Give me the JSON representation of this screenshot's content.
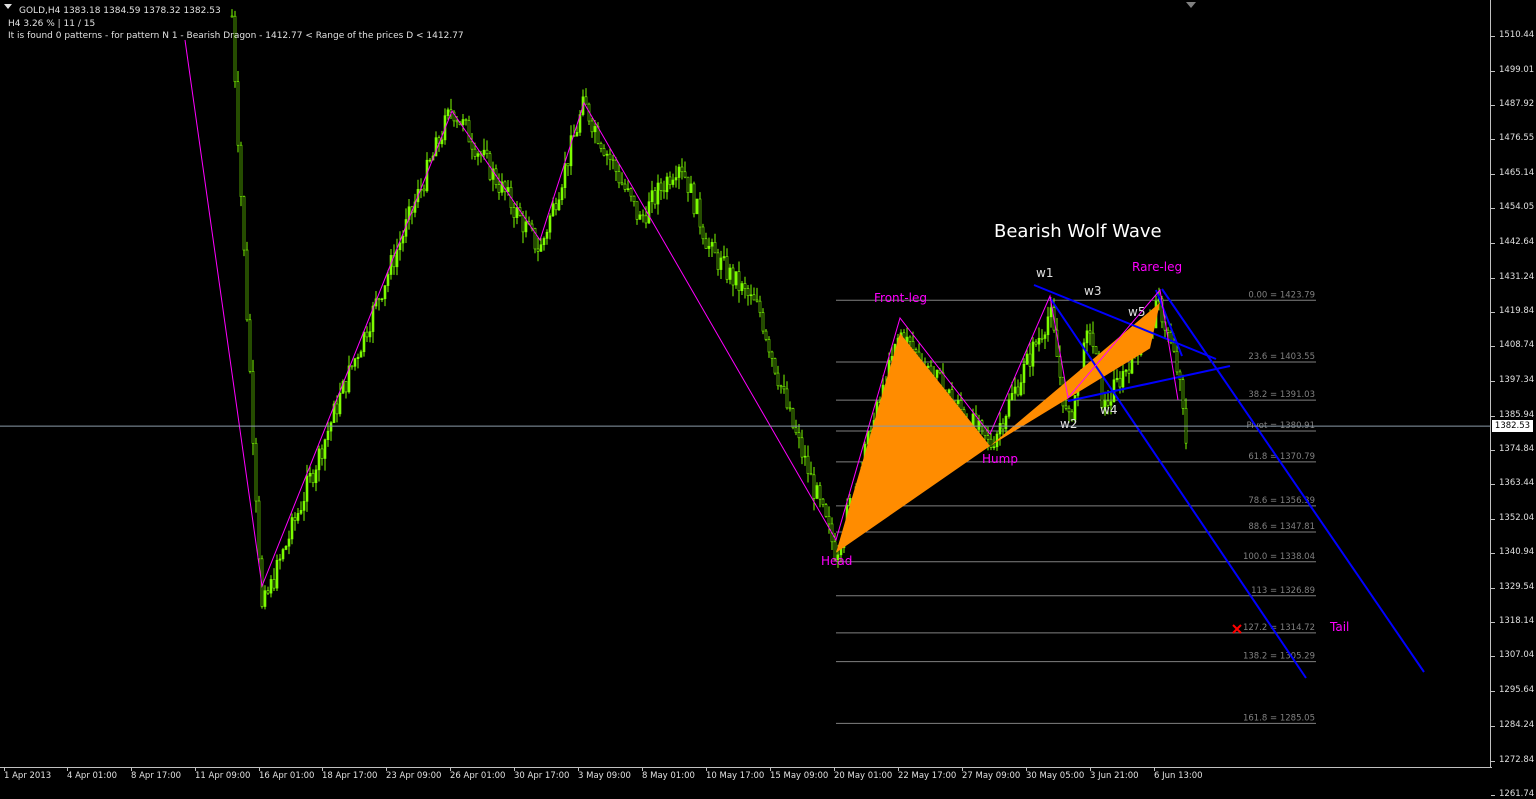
{
  "header": {
    "symbol": "GOLD,H4  1383.18 1384.59 1378.32 1382.53",
    "stats": "H4  3.26 %  |  11 / 15",
    "pattern_info": "It is found 0 patterns  -  for pattern N 1 - Bearish Dragon  - 1412.77 < Range of the prices D < 1412.77"
  },
  "chart_data": {
    "type": "candlestick",
    "title": "Bearish Wolf Wave",
    "ylim": [
      1258,
      1517
    ],
    "current_price": "1382.53",
    "price_ticks": [
      "1510.44",
      "1499.01",
      "1487.92",
      "1476.55",
      "1465.14",
      "1454.05",
      "1442.64",
      "1431.24",
      "1419.84",
      "1408.74",
      "1397.34",
      "1385.94",
      "1374.84",
      "1363.44",
      "1352.04",
      "1340.94",
      "1329.54",
      "1318.14",
      "1307.04",
      "1295.64",
      "1284.24",
      "1272.84",
      "1261.74"
    ],
    "time_ticks": [
      "1 Apr 2013",
      "4 Apr 01:00",
      "8 Apr 17:00",
      "11 Apr 09:00",
      "16 Apr 01:00",
      "18 Apr 17:00",
      "23 Apr 09:00",
      "26 Apr 01:00",
      "30 Apr 17:00",
      "3 May 09:00",
      "8 May 01:00",
      "10 May 17:00",
      "15 May 09:00",
      "20 May 01:00",
      "22 May 17:00",
      "27 May 09:00",
      "30 May 05:00",
      "3 Jun 21:00",
      "6 Jun 13:00"
    ],
    "fibonacci": [
      {
        "label": "0.00 = 1423.79",
        "price": 1423.79
      },
      {
        "label": "23.6 = 1403.55",
        "price": 1403.55
      },
      {
        "label": "38.2 = 1391.03",
        "price": 1391.03
      },
      {
        "label": "Pivot = 1380.91",
        "price": 1380.91
      },
      {
        "label": "61.8 = 1370.79",
        "price": 1370.79
      },
      {
        "label": "78.6 = 1356.39",
        "price": 1356.39
      },
      {
        "label": "88.6 = 1347.81",
        "price": 1347.81
      },
      {
        "label": "100.0 = 1338.04",
        "price": 1338.04
      },
      {
        "label": "113 = 1326.89",
        "price": 1326.89
      },
      {
        "label": "127.2 = 1314.72",
        "price": 1314.72
      },
      {
        "label": "138.2 = 1305.29",
        "price": 1305.29
      },
      {
        "label": "161.8 = 1285.05",
        "price": 1285.05
      }
    ],
    "pattern_labels": {
      "head": "Head",
      "front_leg": "Front-leg",
      "hump": "Hump",
      "rare_leg": "Rare-leg",
      "tail": "Tail",
      "w1": "w1",
      "w2": "w2",
      "w3": "w3",
      "w4": "w4",
      "w5": "w5"
    },
    "colors": {
      "bull": "#7cfc00",
      "pattern_fill": "#ff8c00",
      "pattern_text": "#ff00ff",
      "wave_lines": "#0000ff",
      "zigzag": "#ff00ff",
      "fib_lines": "#808080",
      "fib_text": "#808080",
      "grid": "#c0c0c0",
      "target_marker": "#ff0000"
    }
  }
}
